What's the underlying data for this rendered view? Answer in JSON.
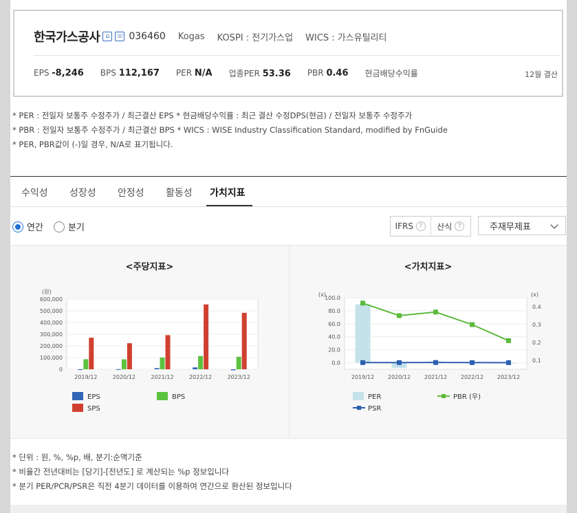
{
  "header": {
    "company_name": "한국가스공사",
    "icon1": "home-icon",
    "icon2": "ir-icon",
    "code": "036460",
    "eng_name": "Kogas",
    "market": "KOSPI : 전기가스업",
    "wics": "WICS : 가스유틸리티",
    "indicators": [
      {
        "label": "EPS",
        "value": "-8,246"
      },
      {
        "label": "BPS",
        "value": "112,167"
      },
      {
        "label": "PER",
        "value": "N/A"
      },
      {
        "label": "업종PER",
        "value": "53.36"
      },
      {
        "label": "PBR",
        "value": "0.46"
      },
      {
        "label": "현금배당수익률",
        "value": ""
      }
    ],
    "settlement": "12월 결산"
  },
  "notes": [
    "* PER : 전일자 보통주 수정주가 / 최근결산 EPS * 현금배당수익률 : 최근 결산 수정DPS(현금) / 전일자 보통주 수정주가",
    "* PBR : 전일자 보통주 수정주가 / 최근결산 BPS * WICS : WISE Industry Classification Standard, modified by FnGuide",
    "* PER, PBR값이 (-)일 경우, N/A로 표기됩니다."
  ],
  "tabs": [
    "수익성",
    "성장성",
    "안정성",
    "활동성",
    "가치지표"
  ],
  "active_tab": "가치지표",
  "period": {
    "annual": "연간",
    "quarter": "분기",
    "selected": "연간"
  },
  "ifrs_label": "IFRS",
  "formula_label": "산식",
  "help_glyph": "?",
  "statement_select": "주재무제표",
  "footnotes": [
    "* 단위 : 원, %, %p, 배, 분기:순액기준",
    "* 비율간 전년대비는 [당기]-[전년도] 로 계산되는 %p 정보입니다",
    "* 분기 PER/PCR/PSR은 직전 4분기 데이터를 이용하여 연간으로 환산된 정보입니다"
  ],
  "chart_data": [
    {
      "type": "bar",
      "title": "<주당지표>",
      "ylabel": "(원)",
      "categories": [
        "2019/12",
        "2020/12",
        "2021/12",
        "2022/12",
        "2023/12"
      ],
      "ylim": [
        0,
        600000
      ],
      "yticks": [
        "0",
        "100,000",
        "200,000",
        "300,000",
        "400,000",
        "500,000",
        "600,000"
      ],
      "series": [
        {
          "name": "EPS",
          "color": "#3466b5",
          "values": [
            -1000,
            1000,
            10000,
            16000,
            -8246
          ]
        },
        {
          "name": "BPS",
          "color": "#5cc23e",
          "values": [
            86000,
            85000,
            101000,
            113000,
            107000
          ]
        },
        {
          "name": "SPS",
          "color": "#d0402f",
          "values": [
            270000,
            223000,
            292000,
            555000,
            483000
          ]
        }
      ],
      "legend_position": "bottom"
    },
    {
      "type": "bar+line",
      "title": "<가치지표>",
      "ylabel_left": "(x)",
      "ylabel_right": "(x)",
      "categories": [
        "2019/12",
        "2020/12",
        "2021/12",
        "2022/12",
        "2023/12"
      ],
      "ylim_left": [
        -10,
        100
      ],
      "yticks_left": [
        "0.0",
        "20.0",
        "40.0",
        "60.0",
        "80.0",
        "100.0"
      ],
      "ylim_right": [
        0.05,
        0.45
      ],
      "yticks_right": [
        "0.1",
        "0.2",
        "0.3",
        "0.4"
      ],
      "series": [
        {
          "name": "PER",
          "kind": "bar",
          "axis": "left",
          "color": "#c5e2ea",
          "values": [
            90,
            -8,
            2,
            0,
            -1
          ]
        },
        {
          "name": "PBR (우)",
          "kind": "line",
          "axis": "right",
          "color": "#5cba3c",
          "values": [
            0.42,
            0.35,
            0.37,
            0.3,
            0.21
          ]
        },
        {
          "name": "PSR",
          "kind": "line",
          "axis": "left",
          "color": "#2d5fb0",
          "values": [
            0.3,
            0.3,
            0.4,
            0.3,
            0.2
          ]
        }
      ],
      "legend_position": "bottom"
    }
  ]
}
